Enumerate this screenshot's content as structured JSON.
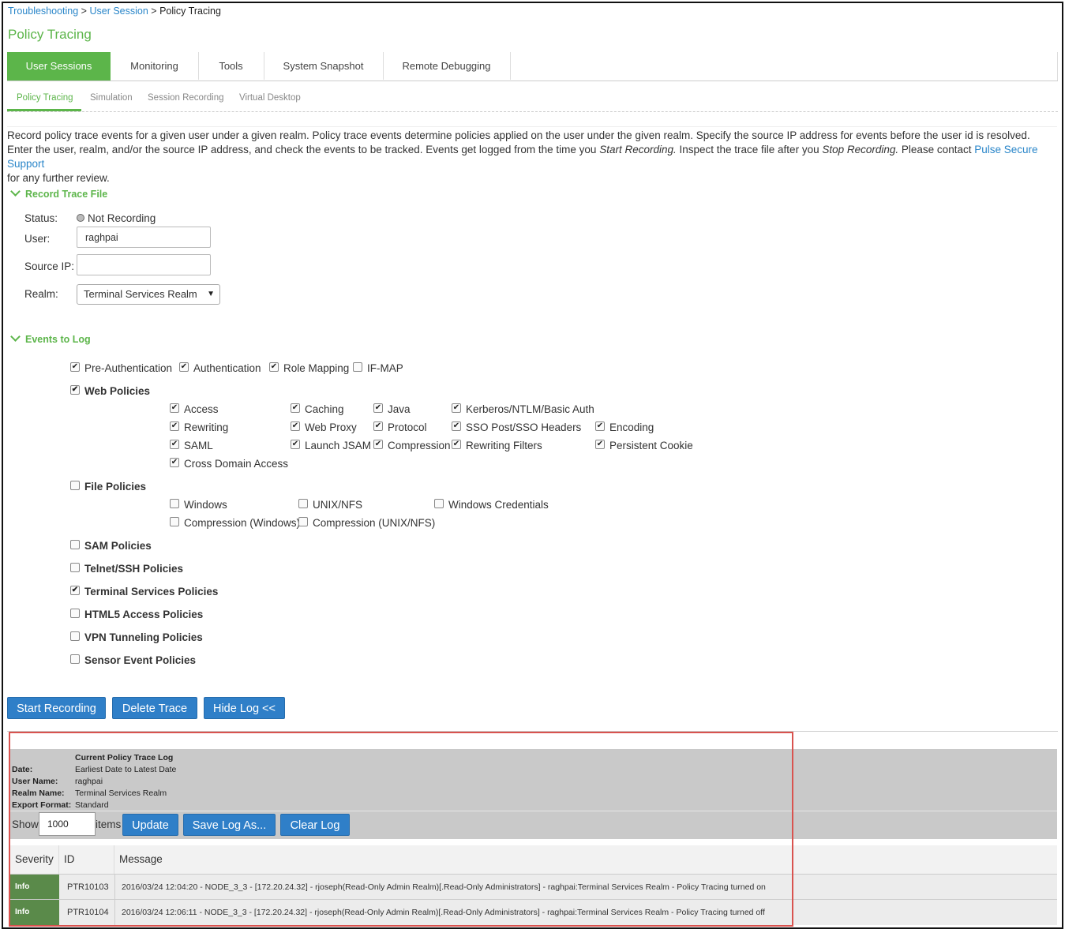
{
  "breadcrumb": {
    "item1": "Troubleshooting",
    "sep": ">",
    "item2": "User Session",
    "item3": "Policy Tracing"
  },
  "page_title": "Policy Tracing",
  "tabs": [
    {
      "label": "User Sessions",
      "active": true
    },
    {
      "label": "Monitoring"
    },
    {
      "label": "Tools"
    },
    {
      "label": "System Snapshot"
    },
    {
      "label": "Remote Debugging"
    }
  ],
  "subtabs": [
    {
      "label": "Policy Tracing",
      "active": true
    },
    {
      "label": "Simulation"
    },
    {
      "label": "Session Recording"
    },
    {
      "label": "Virtual Desktop"
    }
  ],
  "description": {
    "line1": "Record policy trace events for a given user under a given realm. Policy trace events determine policies applied on the user under the given realm. Specify the source IP address for events before the user id is resolved.",
    "line2a": "Enter the user, realm, and/or the source IP address, and check the events to be tracked. Events get logged from the time you ",
    "line2b": "Start Recording.",
    "line2c": " Inspect the trace file after you ",
    "line2d": "Stop Recording.",
    "line2e": " Please contact ",
    "link": "Pulse Secure Support",
    "line3": "for any further review."
  },
  "record": {
    "section": "Record Trace File",
    "status_label": "Status:",
    "status_value": "Not Recording",
    "user_label": "User:",
    "user_value": "raghpai",
    "source_ip_label": "Source IP:",
    "source_ip_value": "",
    "realm_label": "Realm:",
    "realm_value": "Terminal Services Realm"
  },
  "events": {
    "section": "Events to Log",
    "top": [
      {
        "label": "Pre-Authentication",
        "checked": true
      },
      {
        "label": "Authentication",
        "checked": true
      },
      {
        "label": "Role Mapping",
        "checked": true
      },
      {
        "label": "IF-MAP",
        "checked": false
      }
    ],
    "web": {
      "label": "Web Policies",
      "checked": true,
      "items": [
        {
          "label": "Access",
          "checked": true
        },
        {
          "label": "Caching",
          "checked": true
        },
        {
          "label": "Java",
          "checked": true
        },
        {
          "label": "Kerberos/NTLM/Basic Auth",
          "checked": true
        },
        {
          "label": "Rewriting",
          "checked": true
        },
        {
          "label": "Web Proxy",
          "checked": true
        },
        {
          "label": "Protocol",
          "checked": true
        },
        {
          "label": "SSO Post/SSO Headers",
          "checked": true
        },
        {
          "label": "Encoding",
          "checked": true
        },
        {
          "label": "SAML",
          "checked": true
        },
        {
          "label": "Launch JSAM",
          "checked": true
        },
        {
          "label": "Compression",
          "checked": true
        },
        {
          "label": "Rewriting Filters",
          "checked": true
        },
        {
          "label": "Persistent Cookie",
          "checked": true
        },
        {
          "label": "Cross Domain Access",
          "checked": true
        }
      ]
    },
    "file": {
      "label": "File Policies",
      "checked": false,
      "items": [
        {
          "label": "Windows",
          "checked": false
        },
        {
          "label": "UNIX/NFS",
          "checked": false
        },
        {
          "label": "Windows Credentials",
          "checked": false
        },
        {
          "label": "Compression (Windows)",
          "checked": false
        },
        {
          "label": "Compression (UNIX/NFS)",
          "checked": false
        }
      ]
    },
    "others": [
      {
        "label": "SAM Policies",
        "checked": false
      },
      {
        "label": "Telnet/SSH Policies",
        "checked": false
      },
      {
        "label": "Terminal Services Policies",
        "checked": true
      },
      {
        "label": "HTML5 Access Policies",
        "checked": false
      },
      {
        "label": "VPN Tunneling Policies",
        "checked": false
      },
      {
        "label": "Sensor Event Policies",
        "checked": false
      }
    ]
  },
  "buttons": {
    "start": "Start Recording",
    "delete": "Delete Trace",
    "hide": "Hide Log <<"
  },
  "log": {
    "title": "Current Policy Trace Log",
    "date_label": "Date:",
    "date_value": "Earliest Date to Latest Date",
    "user_label": "User Name:",
    "user_value": "raghpai",
    "realm_label": "Realm Name:",
    "realm_value": "Terminal Services Realm",
    "export_label": "Export Format:",
    "export_value": "Standard",
    "show_label": "Show",
    "show_value": "1000",
    "items_label": "items",
    "update": "Update",
    "save": "Save Log As...",
    "clear": "Clear Log",
    "columns": [
      "Severity",
      "ID",
      "Message"
    ],
    "rows": [
      {
        "severity": "Info",
        "id": "PTR10103",
        "message": "2016/03/24 12:04:20 - NODE_3_3 - [172.20.24.32] - rjoseph(Read-Only Admin Realm)[.Read-Only Administrators] - raghpai:Terminal Services Realm - Policy Tracing turned on"
      },
      {
        "severity": "Info",
        "id": "PTR10104",
        "message": "2016/03/24 12:06:11 - NODE_3_3 - [172.20.24.32] - rjoseph(Read-Only Admin Realm)[.Read-Only Administrators] - raghpai:Terminal Services Realm - Policy Tracing turned off"
      }
    ]
  }
}
